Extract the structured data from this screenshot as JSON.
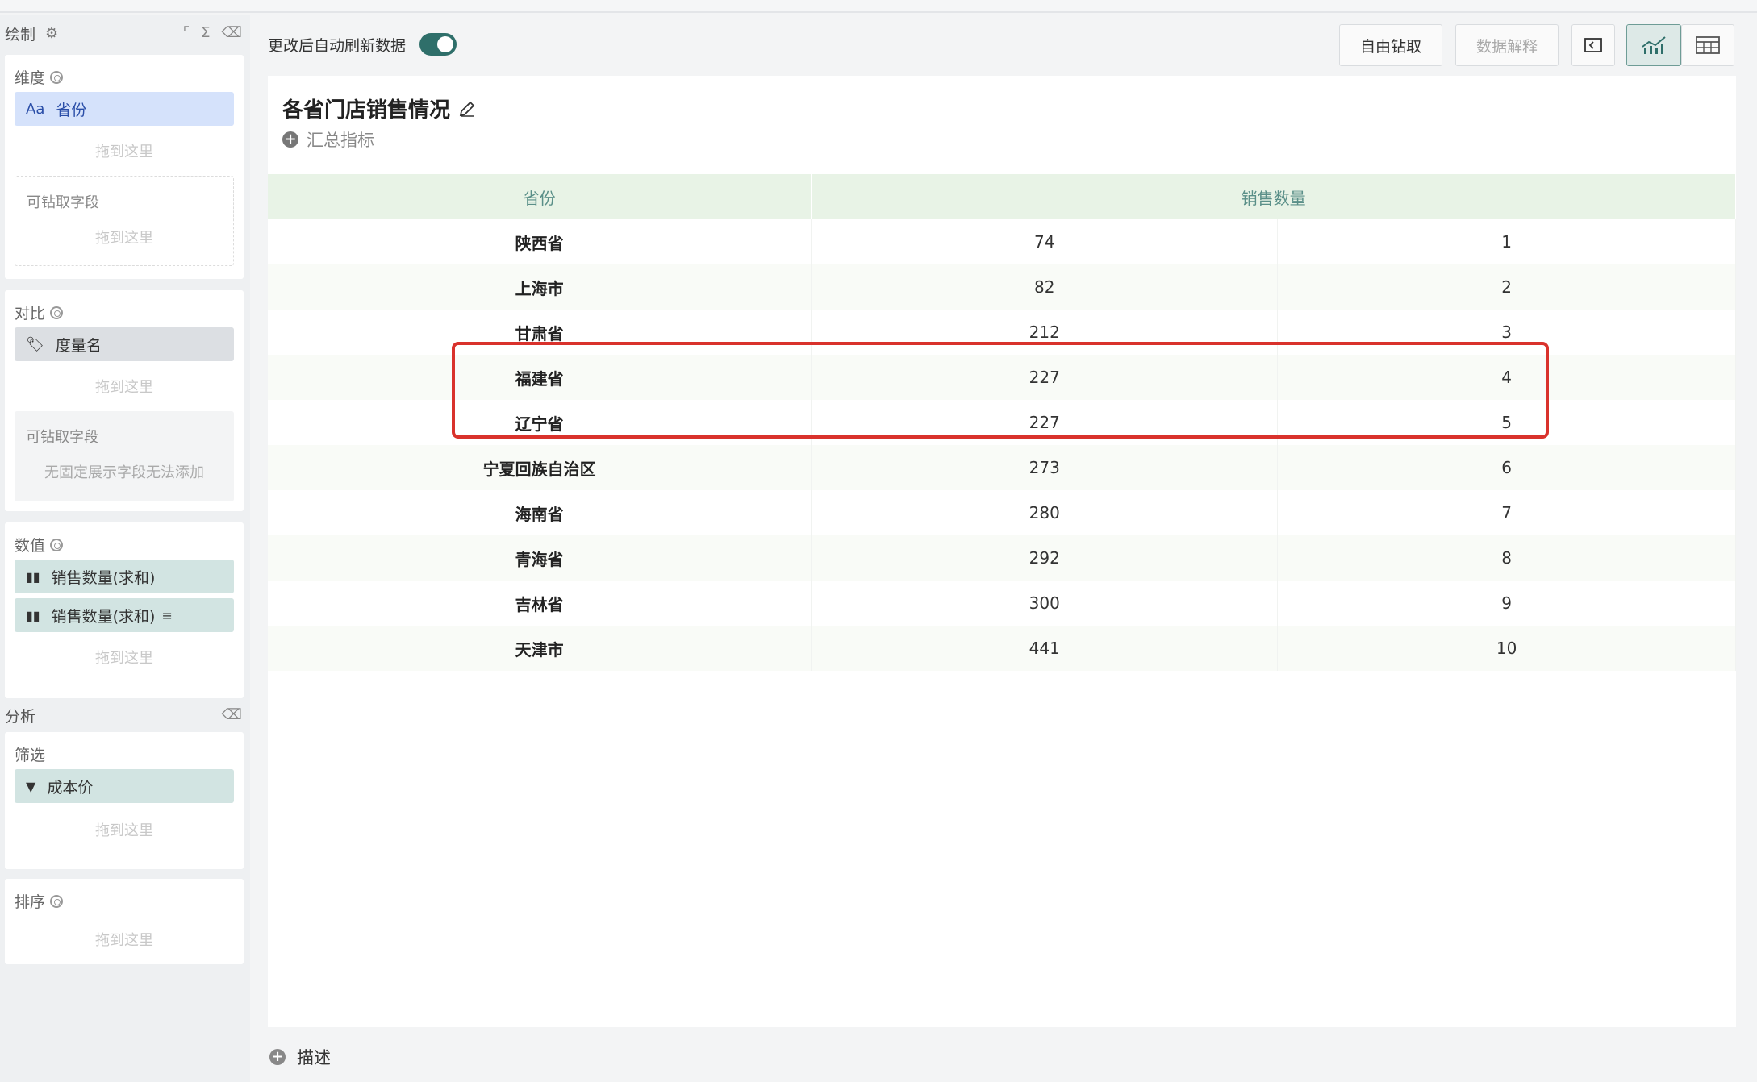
{
  "left_panel": {
    "draw_label": "绘制",
    "dimension": {
      "title": "维度",
      "field": "省份",
      "field_icon": "Aa",
      "drop": "拖到这里",
      "drill_label": "可钻取字段",
      "drill_drop": "拖到这里"
    },
    "compare": {
      "title": "对比",
      "field": "度量名",
      "drop": "拖到这里",
      "drill_label": "可钻取字段",
      "drill_note": "无固定展示字段无法添加"
    },
    "values": {
      "title": "数值",
      "fields": [
        "销售数量(求和)",
        "销售数量(求和)"
      ],
      "drop": "拖到这里"
    },
    "analysis_label": "分析",
    "filter": {
      "title": "筛选",
      "field": "成本价",
      "drop": "拖到这里"
    },
    "sort": {
      "title": "排序",
      "drop": "拖到这里"
    }
  },
  "toolbar": {
    "auto_refresh_label": "更改后自动刷新数据",
    "auto_refresh_on": true,
    "free_drill": "自由钻取",
    "data_explain": "数据解释"
  },
  "chart": {
    "title": "各省门店销售情况",
    "summary": "汇总指标",
    "columns": [
      "省份",
      "销售数量"
    ],
    "rows": [
      {
        "province": "陕西省",
        "value": "74",
        "rank": "1"
      },
      {
        "province": "上海市",
        "value": "82",
        "rank": "2"
      },
      {
        "province": "甘肃省",
        "value": "212",
        "rank": "3"
      },
      {
        "province": "福建省",
        "value": "227",
        "rank": "4"
      },
      {
        "province": "辽宁省",
        "value": "227",
        "rank": "5"
      },
      {
        "province": "宁夏回族自治区",
        "value": "273",
        "rank": "6"
      },
      {
        "province": "海南省",
        "value": "280",
        "rank": "7"
      },
      {
        "province": "青海省",
        "value": "292",
        "rank": "8"
      },
      {
        "province": "吉林省",
        "value": "300",
        "rank": "9"
      },
      {
        "province": "天津市",
        "value": "441",
        "rank": "10"
      }
    ],
    "highlight_color": "#d9322c"
  },
  "footer": {
    "describe": "描述"
  },
  "colors": {
    "accent": "#2f6f6a",
    "header_bg": "#e8f3e6",
    "header_text": "#5a8f88"
  }
}
